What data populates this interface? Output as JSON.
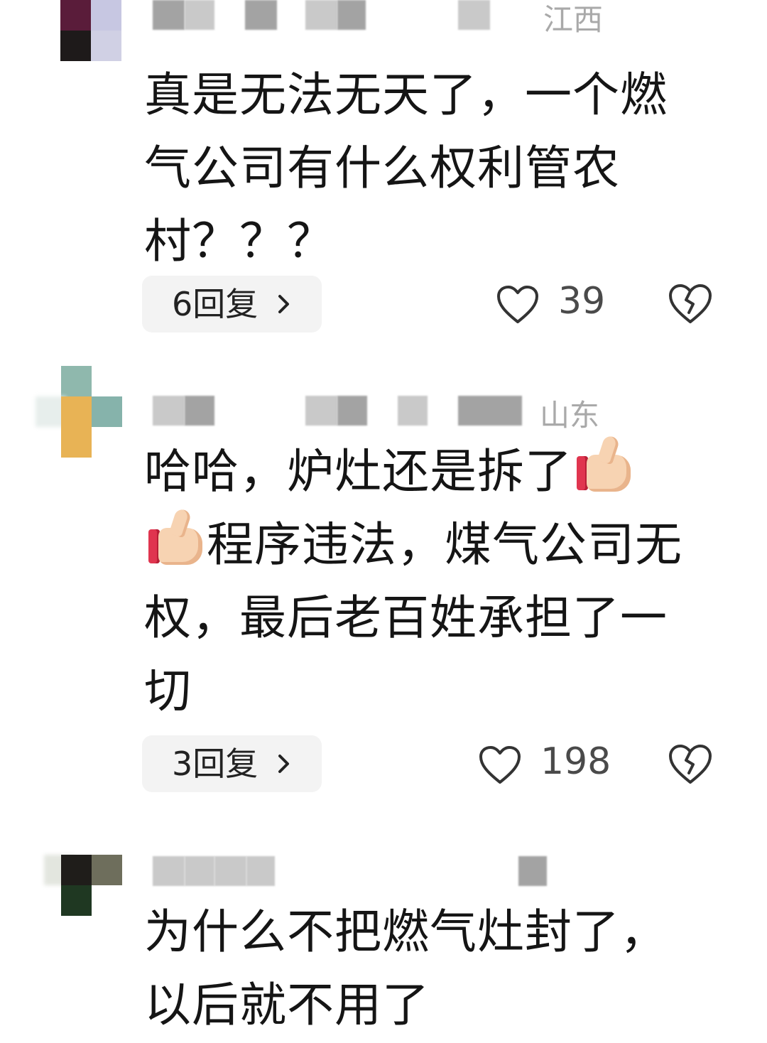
{
  "comments": [
    {
      "region": "江西",
      "text": "真是无法无天了，一个燃气公司有什么权利管农村？？？",
      "text_lines": [
        "真是无法无天了，一个燃",
        "气公司有什么权利管农",
        "村？？？"
      ],
      "replies_label": "6回复",
      "likes": "39",
      "avatar_colors": [
        "#5a1c3a",
        "#c7c7e2",
        "#1e1a1a",
        "#d0d0e4"
      ]
    },
    {
      "region": "山东",
      "text_lines": [
        "哈哈，炉灶还是拆了",
        "程序违法，煤气公司无",
        "权，最后老百姓承担了一",
        "切"
      ],
      "replies_label": "3回复",
      "likes": "198",
      "emoji": "thumbs-up",
      "avatar_colors": [
        "#8fb8ad",
        "#e8b355",
        "#86b3ab"
      ]
    },
    {
      "region": "",
      "text_lines": [
        "为什么不把燃气灶封了，",
        "以后就不用了"
      ],
      "avatar_colors": [
        "#1f1d1a",
        "#6e6e5c",
        "#1f3822"
      ]
    }
  ],
  "icons": {
    "like": "heart-outline-icon",
    "dislike": "broken-heart-icon",
    "more": "chevron-right-icon"
  }
}
